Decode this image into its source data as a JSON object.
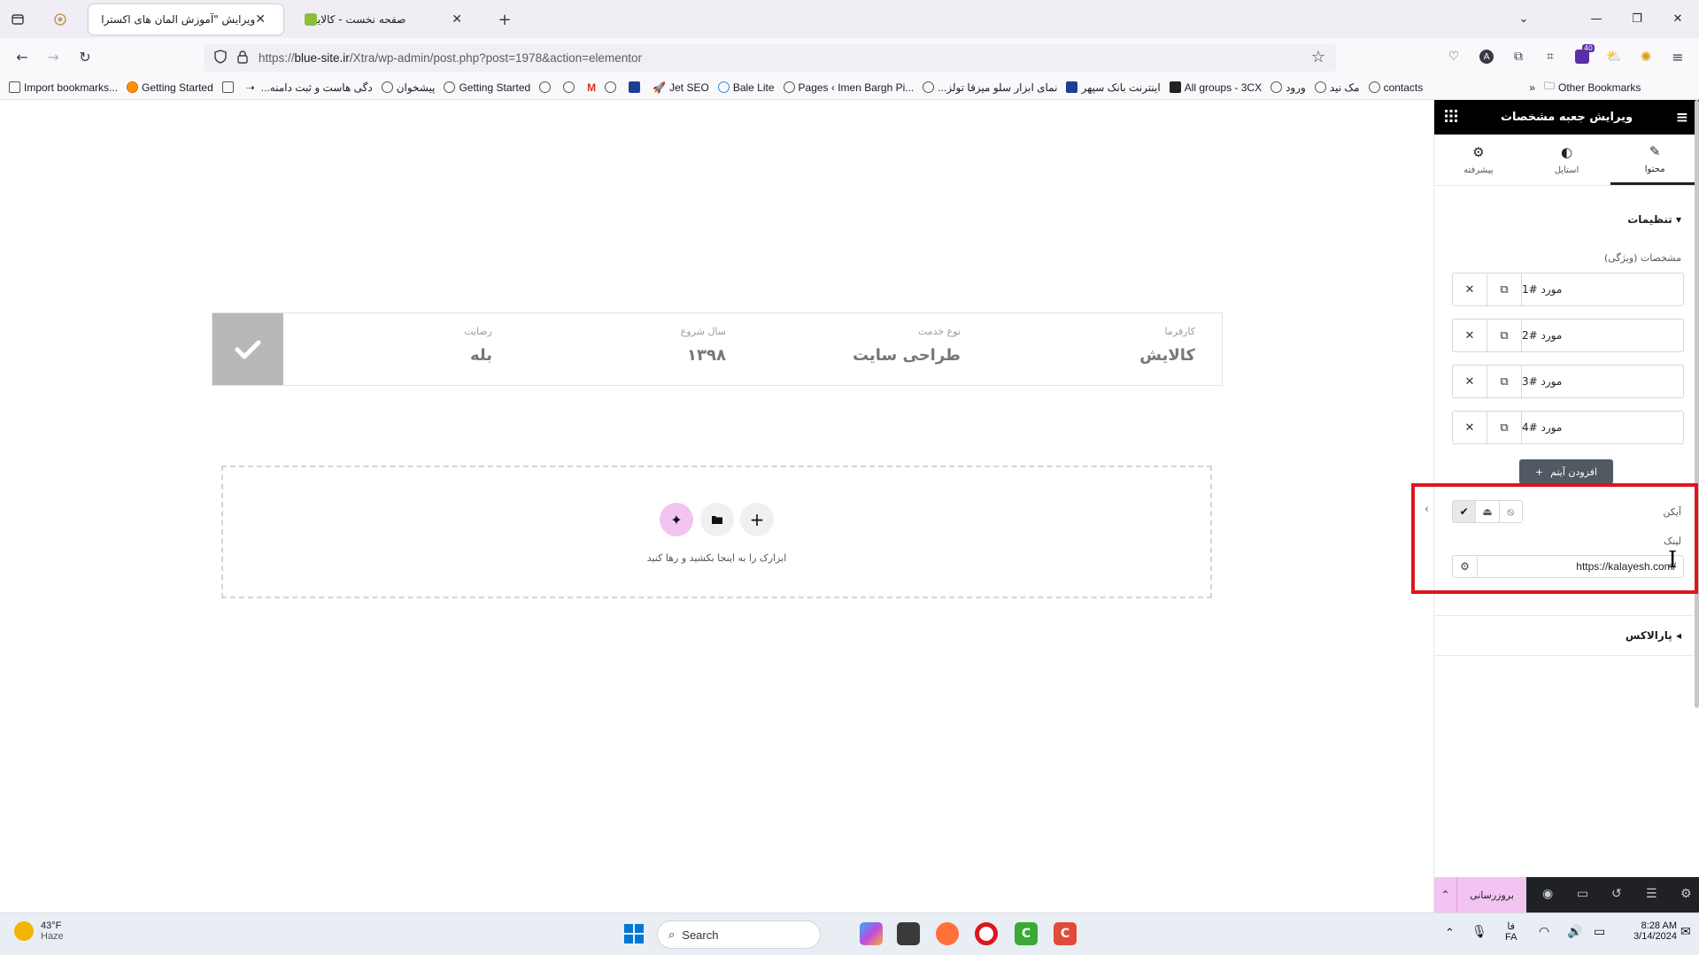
{
  "browser": {
    "tabs": [
      {
        "title": "ویرایش \"آموزش المان های اکسترا – ...",
        "active": true
      },
      {
        "title": "صفحه نخست - کالایش",
        "active": false
      }
    ],
    "new_tab": "+",
    "url_prefix": "https://",
    "url_host": "blue-site.ir",
    "url_path": "/Xtra/wp-admin/post.php?post=1978&action=elementor",
    "extension_badge": "40"
  },
  "bookmarks": [
    "Import bookmarks...",
    "Getting Started",
    "...دگی هاست و ثبت دامنه",
    "پیشخوان",
    "Getting Started",
    "Jet SEO",
    "Bale Lite",
    "Pages ‹ Imen Bargh Pi...",
    "...نمای ابزار سلو میزفا تولز",
    "اینترنت بانک سپهر",
    "All groups - 3CX",
    "ورود",
    "مک نید",
    "contacts"
  ],
  "other_bookmarks": "Other Bookmarks",
  "canvas": {
    "spec_items": [
      {
        "label": "کارفرما",
        "value": "کالایش"
      },
      {
        "label": "نوع خدمت",
        "value": "طراحی سایت"
      },
      {
        "label": "سال شروع",
        "value": "۱۳۹۸"
      },
      {
        "label": "رضایت",
        "value": "بله"
      }
    ],
    "drop_text": "ابزارک را به اینجا بکشید و رها کنید"
  },
  "panel": {
    "title": "ویرایش جعبه مشخصات",
    "tabs": [
      {
        "label": "محتوا",
        "icon": "pencil-icon",
        "active": true
      },
      {
        "label": "استایل",
        "icon": "half-circle-icon",
        "active": false
      },
      {
        "label": "پیشرفته",
        "icon": "gear-icon",
        "active": false
      }
    ],
    "section_title": "تنظیمات",
    "repeater_label": "مشخصات (ویژگی)",
    "items": [
      "مورد #1",
      "مورد #2",
      "مورد #3",
      "مورد #4"
    ],
    "add_item": "افزودن آیتم",
    "icon_label": "آیکن",
    "link_label": "لینک",
    "link_value": "https://kalayesh.com/",
    "parallax_title": "پارالاکس",
    "publish_label": "بروزرسانی"
  },
  "taskbar": {
    "temperature": "43°F",
    "weather": "Haze",
    "search_placeholder": "Search",
    "lang_top": "فا",
    "lang_bottom": "FA",
    "time": "8:28 AM",
    "date": "3/14/2024"
  }
}
